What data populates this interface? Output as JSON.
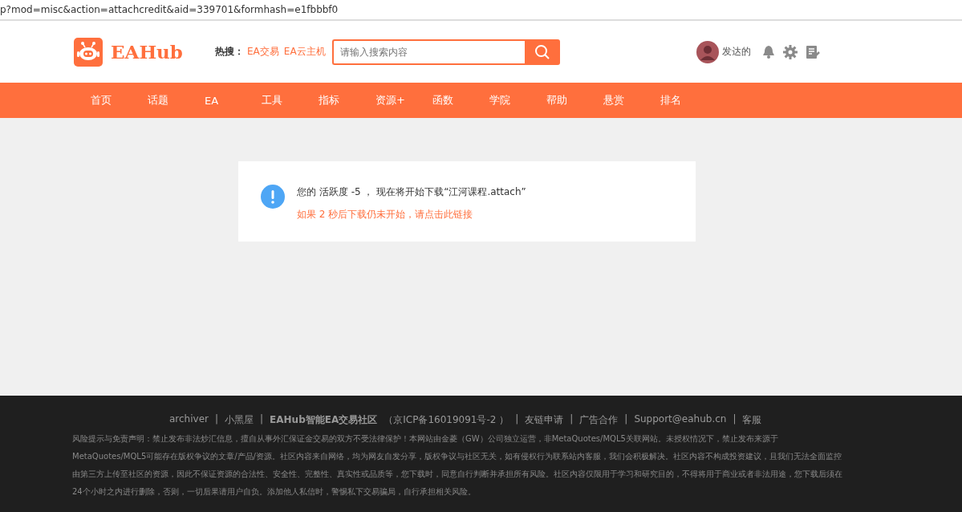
{
  "address_bar": {
    "url": "p?mod=misc&action=attachcredit&aid=339701&formhash=e1fbbbf0"
  },
  "header": {
    "logo_text": "EAHub",
    "hot_label": "热搜：",
    "hot_links": [
      "EA交易",
      "EA云主机"
    ],
    "search": {
      "placeholder": "请输入搜索内容"
    },
    "user": {
      "name": "发达的"
    }
  },
  "nav": [
    "首页",
    "话题",
    "EA",
    "工具",
    "指标",
    "资源+",
    "函数",
    "学院",
    "帮助",
    "悬赏",
    "排名"
  ],
  "notice": {
    "message": "您的 活跃度 -5 ， 现在将开始下载“江河课程.attach”",
    "link": "如果 2 秒后下载仍未开始，请点击此链接"
  },
  "footer": {
    "links": [
      {
        "kind": "link",
        "text": "archiver"
      },
      {
        "kind": "separator",
        "text": "|"
      },
      {
        "kind": "link",
        "text": "小黑屋"
      },
      {
        "kind": "separator",
        "text": "|"
      },
      {
        "kind": "bold",
        "text": "EAHub智能EA交易社区"
      },
      {
        "kind": "text",
        "text": "（京ICP备16019091号-2 ）"
      },
      {
        "kind": "separator",
        "text": "|"
      },
      {
        "kind": "link",
        "text": "友链申请"
      },
      {
        "kind": "separator",
        "text": "|"
      },
      {
        "kind": "link",
        "text": "广告合作"
      },
      {
        "kind": "separator",
        "text": "|"
      },
      {
        "kind": "link",
        "text": "Support@eahub.cn"
      },
      {
        "kind": "separator",
        "text": "|"
      },
      {
        "kind": "link",
        "text": "客服"
      }
    ],
    "disclaimer": [
      "风险提示与免责声明：禁止发布非法炒汇信息，擅自从事外汇保证金交易的双方不受法律保护！本网站由金菱（GW）公司独立运营，非MetaQuotes/MQL5关联网站。未授权情况下，禁止发布来源于",
      "MetaQuotes/MQL5可能存在版权争议的文章/产品/资源。社区内容来自网络，均为网友自发分享，版权争议与社区无关，如有侵权行为联系站内客服，我们会积极解决。社区内容不构成投资建议，且我们无法全面监控",
      "由第三方上传至社区的资源，因此不保证资源的合法性、安全性、完整性、真实性或品质等，您下载时，同意自行判断并承担所有风险。社区内容仅限用于学习和研究目的，不得将用于商业或者非法用途，您下载后须在",
      "24个小时之内进行删除，否则，一切后果请用户自负。添加他人私信时，警惕私下交易骗局，自行承担相关风险。"
    ]
  }
}
